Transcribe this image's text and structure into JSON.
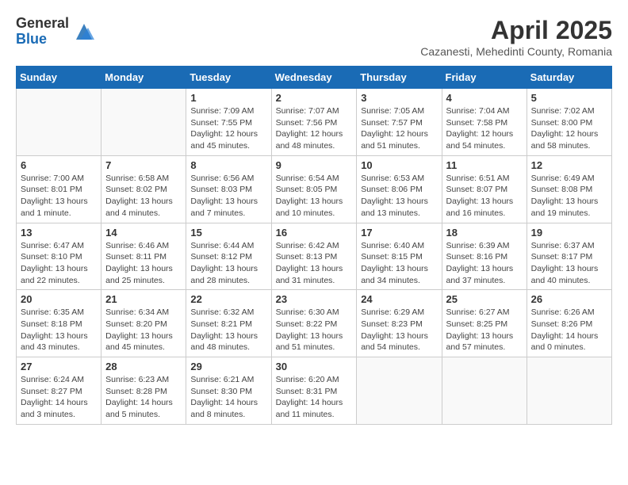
{
  "logo": {
    "general": "General",
    "blue": "Blue"
  },
  "title": "April 2025",
  "subtitle": "Cazanesti, Mehedinti County, Romania",
  "days_of_week": [
    "Sunday",
    "Monday",
    "Tuesday",
    "Wednesday",
    "Thursday",
    "Friday",
    "Saturday"
  ],
  "weeks": [
    [
      {
        "day": "",
        "info": ""
      },
      {
        "day": "",
        "info": ""
      },
      {
        "day": "1",
        "info": "Sunrise: 7:09 AM\nSunset: 7:55 PM\nDaylight: 12 hours and 45 minutes."
      },
      {
        "day": "2",
        "info": "Sunrise: 7:07 AM\nSunset: 7:56 PM\nDaylight: 12 hours and 48 minutes."
      },
      {
        "day": "3",
        "info": "Sunrise: 7:05 AM\nSunset: 7:57 PM\nDaylight: 12 hours and 51 minutes."
      },
      {
        "day": "4",
        "info": "Sunrise: 7:04 AM\nSunset: 7:58 PM\nDaylight: 12 hours and 54 minutes."
      },
      {
        "day": "5",
        "info": "Sunrise: 7:02 AM\nSunset: 8:00 PM\nDaylight: 12 hours and 58 minutes."
      }
    ],
    [
      {
        "day": "6",
        "info": "Sunrise: 7:00 AM\nSunset: 8:01 PM\nDaylight: 13 hours and 1 minute."
      },
      {
        "day": "7",
        "info": "Sunrise: 6:58 AM\nSunset: 8:02 PM\nDaylight: 13 hours and 4 minutes."
      },
      {
        "day": "8",
        "info": "Sunrise: 6:56 AM\nSunset: 8:03 PM\nDaylight: 13 hours and 7 minutes."
      },
      {
        "day": "9",
        "info": "Sunrise: 6:54 AM\nSunset: 8:05 PM\nDaylight: 13 hours and 10 minutes."
      },
      {
        "day": "10",
        "info": "Sunrise: 6:53 AM\nSunset: 8:06 PM\nDaylight: 13 hours and 13 minutes."
      },
      {
        "day": "11",
        "info": "Sunrise: 6:51 AM\nSunset: 8:07 PM\nDaylight: 13 hours and 16 minutes."
      },
      {
        "day": "12",
        "info": "Sunrise: 6:49 AM\nSunset: 8:08 PM\nDaylight: 13 hours and 19 minutes."
      }
    ],
    [
      {
        "day": "13",
        "info": "Sunrise: 6:47 AM\nSunset: 8:10 PM\nDaylight: 13 hours and 22 minutes."
      },
      {
        "day": "14",
        "info": "Sunrise: 6:46 AM\nSunset: 8:11 PM\nDaylight: 13 hours and 25 minutes."
      },
      {
        "day": "15",
        "info": "Sunrise: 6:44 AM\nSunset: 8:12 PM\nDaylight: 13 hours and 28 minutes."
      },
      {
        "day": "16",
        "info": "Sunrise: 6:42 AM\nSunset: 8:13 PM\nDaylight: 13 hours and 31 minutes."
      },
      {
        "day": "17",
        "info": "Sunrise: 6:40 AM\nSunset: 8:15 PM\nDaylight: 13 hours and 34 minutes."
      },
      {
        "day": "18",
        "info": "Sunrise: 6:39 AM\nSunset: 8:16 PM\nDaylight: 13 hours and 37 minutes."
      },
      {
        "day": "19",
        "info": "Sunrise: 6:37 AM\nSunset: 8:17 PM\nDaylight: 13 hours and 40 minutes."
      }
    ],
    [
      {
        "day": "20",
        "info": "Sunrise: 6:35 AM\nSunset: 8:18 PM\nDaylight: 13 hours and 43 minutes."
      },
      {
        "day": "21",
        "info": "Sunrise: 6:34 AM\nSunset: 8:20 PM\nDaylight: 13 hours and 45 minutes."
      },
      {
        "day": "22",
        "info": "Sunrise: 6:32 AM\nSunset: 8:21 PM\nDaylight: 13 hours and 48 minutes."
      },
      {
        "day": "23",
        "info": "Sunrise: 6:30 AM\nSunset: 8:22 PM\nDaylight: 13 hours and 51 minutes."
      },
      {
        "day": "24",
        "info": "Sunrise: 6:29 AM\nSunset: 8:23 PM\nDaylight: 13 hours and 54 minutes."
      },
      {
        "day": "25",
        "info": "Sunrise: 6:27 AM\nSunset: 8:25 PM\nDaylight: 13 hours and 57 minutes."
      },
      {
        "day": "26",
        "info": "Sunrise: 6:26 AM\nSunset: 8:26 PM\nDaylight: 14 hours and 0 minutes."
      }
    ],
    [
      {
        "day": "27",
        "info": "Sunrise: 6:24 AM\nSunset: 8:27 PM\nDaylight: 14 hours and 3 minutes."
      },
      {
        "day": "28",
        "info": "Sunrise: 6:23 AM\nSunset: 8:28 PM\nDaylight: 14 hours and 5 minutes."
      },
      {
        "day": "29",
        "info": "Sunrise: 6:21 AM\nSunset: 8:30 PM\nDaylight: 14 hours and 8 minutes."
      },
      {
        "day": "30",
        "info": "Sunrise: 6:20 AM\nSunset: 8:31 PM\nDaylight: 14 hours and 11 minutes."
      },
      {
        "day": "",
        "info": ""
      },
      {
        "day": "",
        "info": ""
      },
      {
        "day": "",
        "info": ""
      }
    ]
  ]
}
